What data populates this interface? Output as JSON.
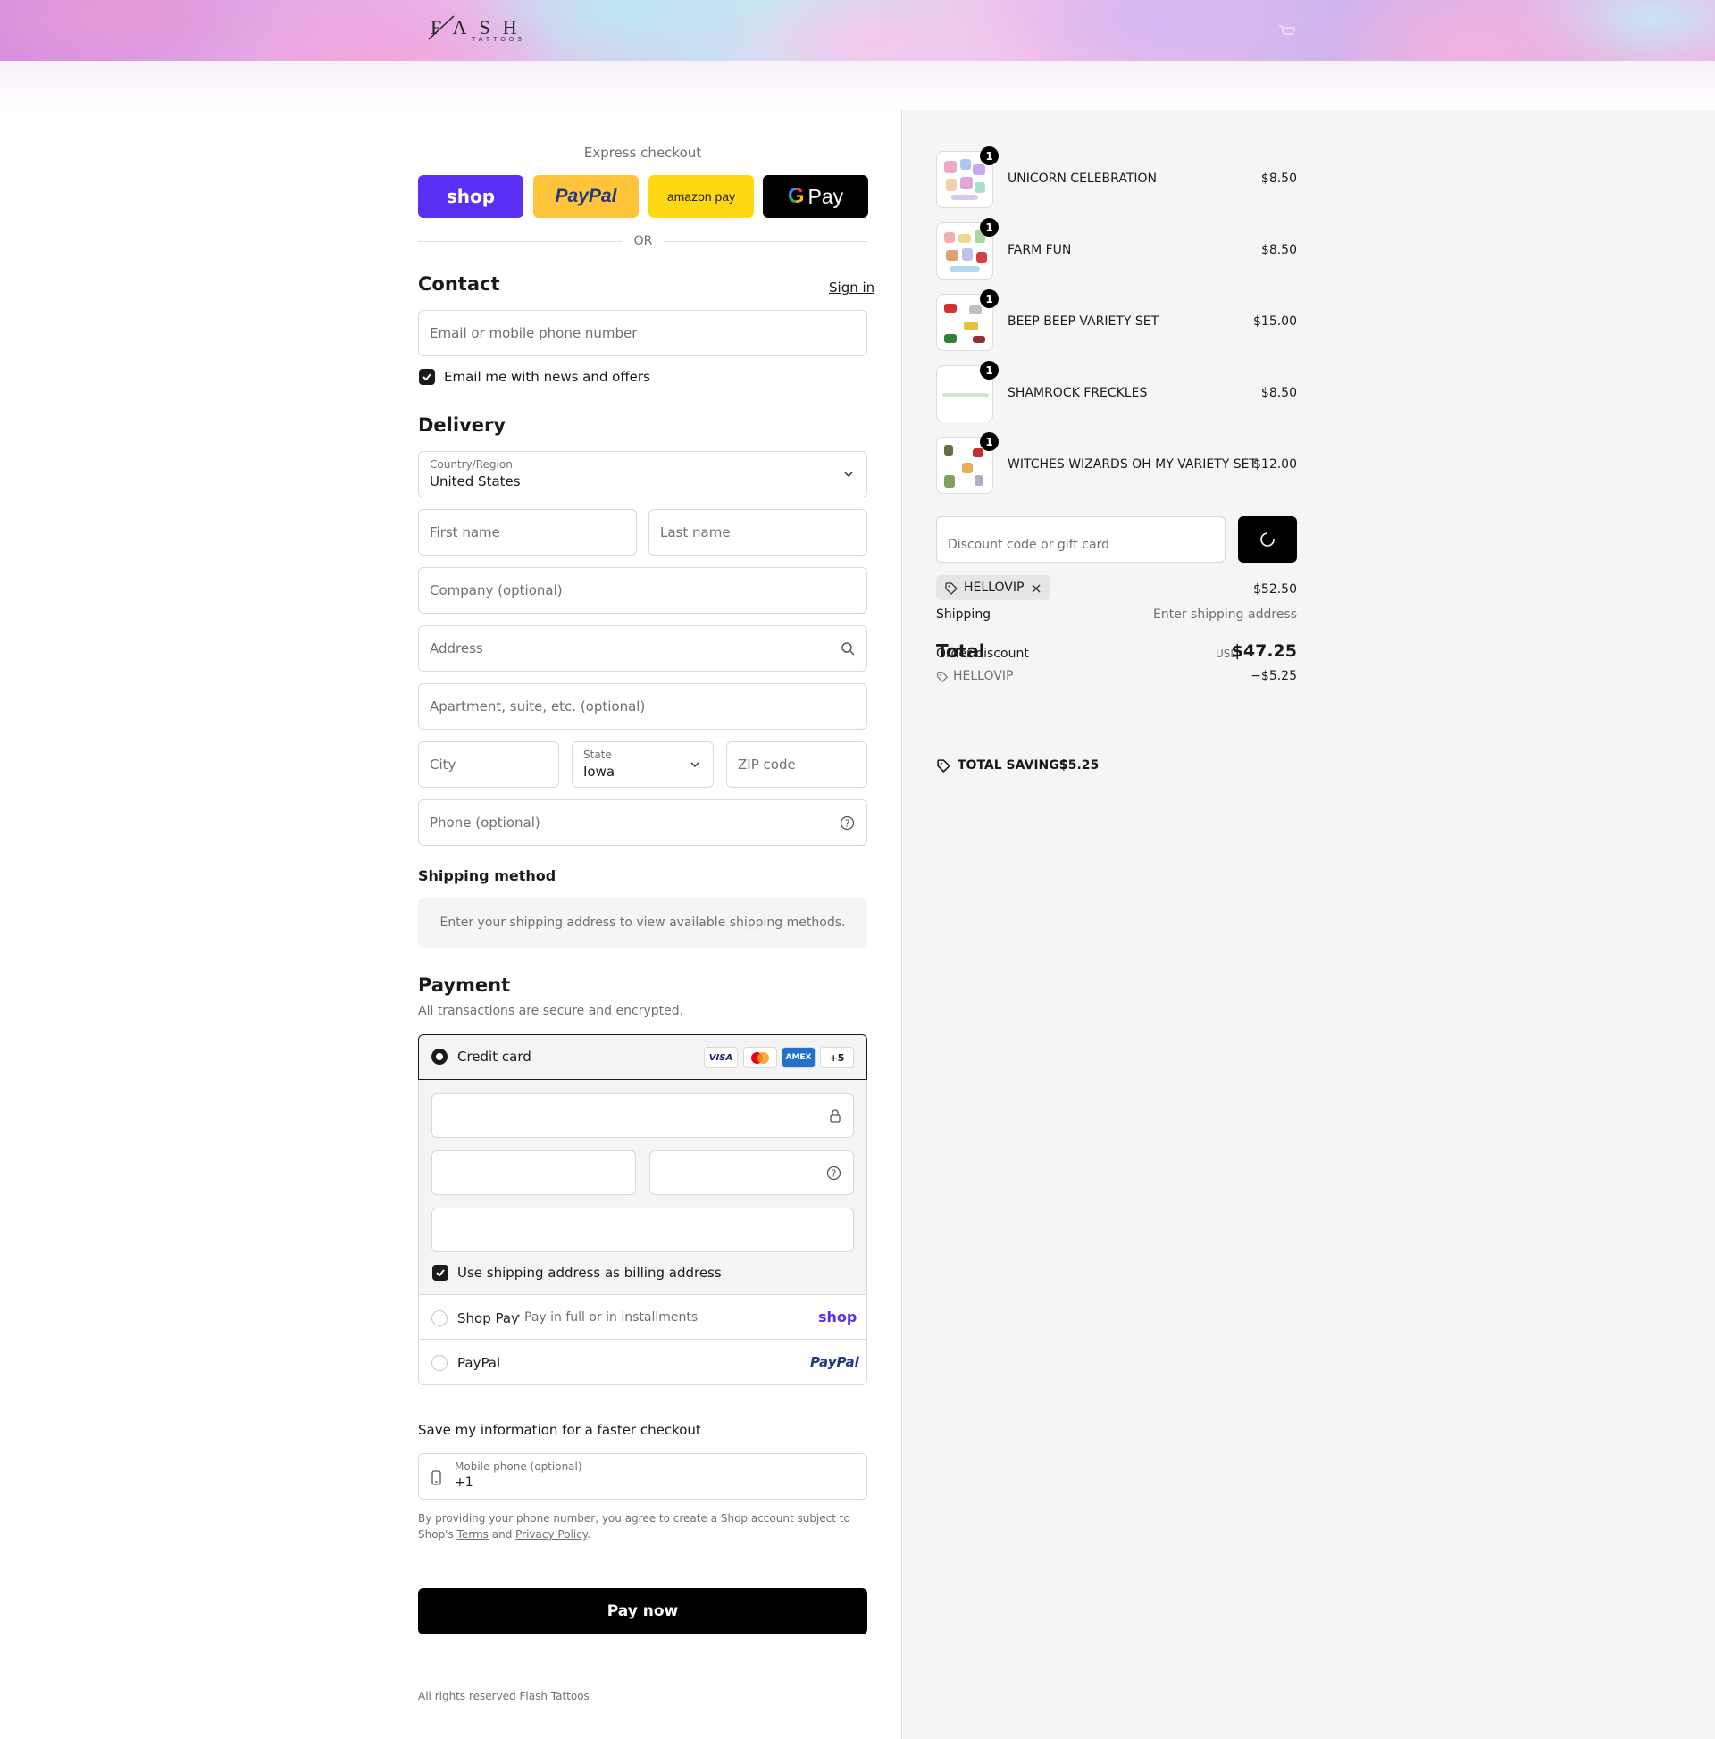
{
  "header": {
    "logo_text": "FLASH",
    "logo_sub": "TATTOOS"
  },
  "express": {
    "label": "Express checkout",
    "shop_label": "shop",
    "paypal_label": "PayPal",
    "amazon_label": "amazon pay",
    "gpay_label": "Pay",
    "or_label": "OR"
  },
  "contact": {
    "heading": "Contact",
    "sign_in": "Sign in",
    "email_placeholder": "Email or mobile phone number",
    "newsletter_label": "Email me with news and offers",
    "newsletter_checked": true
  },
  "delivery": {
    "heading": "Delivery",
    "country_label": "Country/Region",
    "country_value": "United States",
    "first_name_ph": "First name",
    "last_name_ph": "Last name",
    "company_ph": "Company (optional)",
    "address_ph": "Address",
    "apartment_ph": "Apartment, suite, etc. (optional)",
    "city_ph": "City",
    "state_label": "State",
    "state_value": "Iowa",
    "zip_ph": "ZIP code",
    "phone_ph": "Phone (optional)"
  },
  "shipping_method": {
    "heading": "Shipping method",
    "message": "Enter your shipping address to view available shipping methods."
  },
  "payment": {
    "heading": "Payment",
    "subtitle": "All transactions are secure and encrypted.",
    "credit_card_label": "Credit card",
    "card_brands": [
      "VISA",
      "Mastercard",
      "AMEX"
    ],
    "more_brands": "+5",
    "billing_same_label": "Use shipping address as billing address",
    "billing_same_checked": true,
    "shop_pay_label": "Shop Pay",
    "shop_pay_sep": "•",
    "shop_pay_desc": "Pay in full or in installments",
    "shop_pay_logo": "shop",
    "paypal_label": "PayPal",
    "paypal_logo": "PayPal"
  },
  "save_info": {
    "heading": "Save my information for a faster checkout",
    "mobile_label": "Mobile phone (optional)",
    "mobile_value": "+1",
    "legal_prefix": "By providing your phone number, you agree to create a Shop account subject to Shop's",
    "terms_link": "Terms",
    "and": "and",
    "privacy_link": "Privacy Policy",
    "period": "."
  },
  "pay_now_label": "Pay now",
  "footer": "All rights reserved Flash Tattoos",
  "order": {
    "items": [
      {
        "name": "UNICORN CELEBRATION",
        "price": "$8.50",
        "qty": "1"
      },
      {
        "name": "FARM FUN",
        "price": "$8.50",
        "qty": "1"
      },
      {
        "name": "BEEP BEEP VARIETY SET",
        "price": "$15.00",
        "qty": "1"
      },
      {
        "name": "SHAMROCK FRECKLES",
        "price": "$8.50",
        "qty": "1"
      },
      {
        "name": "WITCHES WIZARDS OH MY VARIETY SET",
        "price": "$12.00",
        "qty": "1"
      }
    ],
    "discount_placeholder": "Discount code or gift card",
    "applied_code": "HELLOVIP",
    "subtotal_value": "$52.50",
    "shipping_label": "Shipping",
    "shipping_value": "Enter shipping address",
    "order_discount_label": "Order discount",
    "discount_code_line": "HELLOVIP",
    "discount_amount": "−$5.25",
    "total_label": "Total",
    "currency": "USD",
    "total_value": "$47.25",
    "total_savings_label": "TOTAL SAVINGS",
    "total_savings_value": "$5.25"
  },
  "colors": {
    "shop_purple": "#5a31f4",
    "paypal_yellow": "#ffc439",
    "amazon_yellow": "#ffd814",
    "black": "#000000"
  }
}
